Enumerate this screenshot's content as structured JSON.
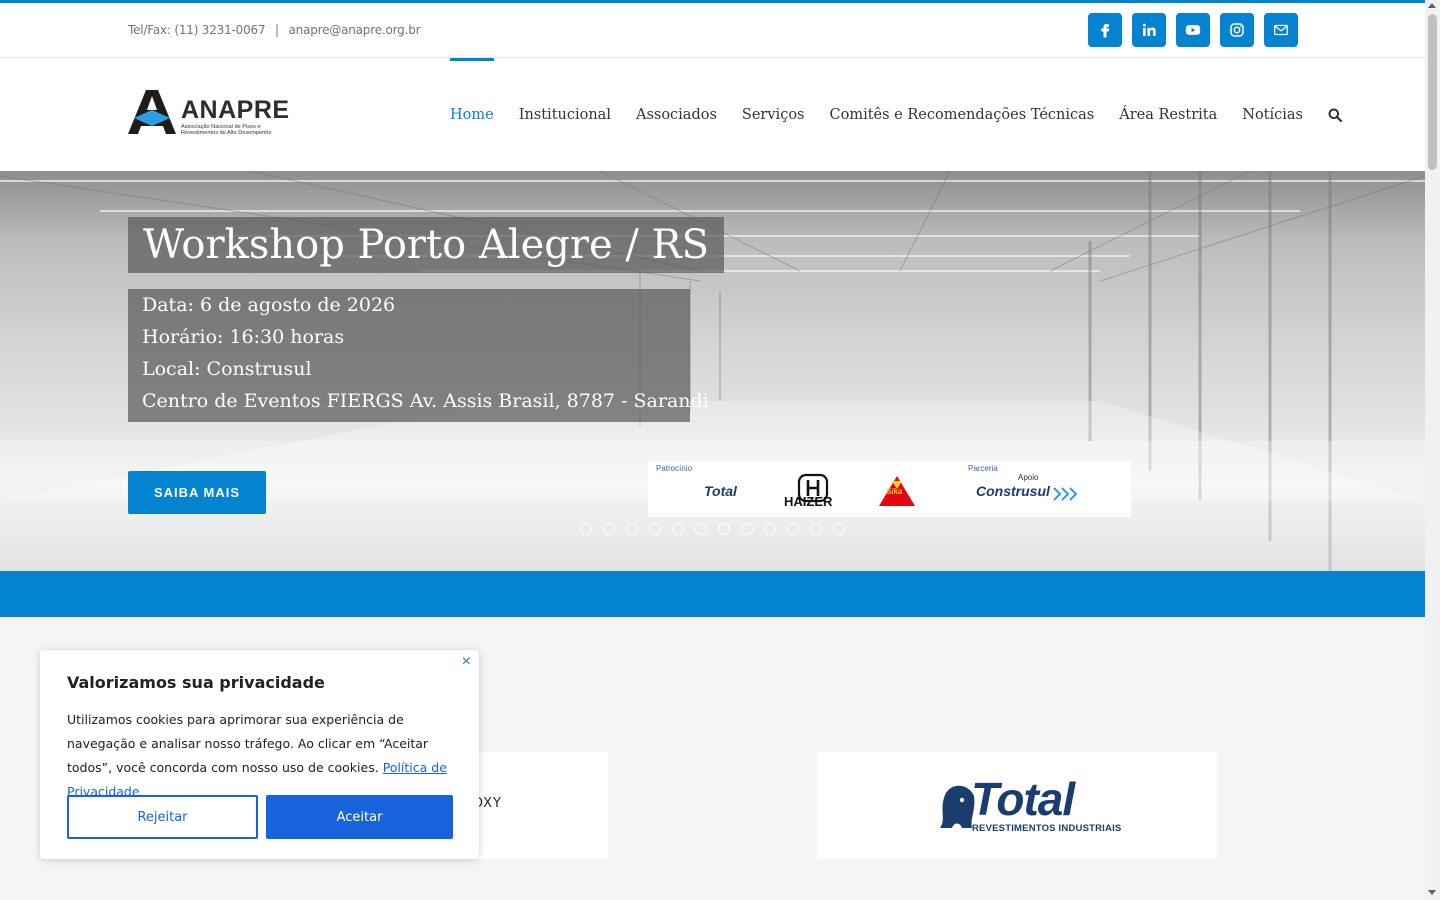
{
  "topbar": {
    "phone": "Tel/Fax: (11) 3231-0067",
    "separator": "|",
    "email": "anapre@anapre.org.br",
    "socials": [
      "facebook-icon",
      "linkedin-icon",
      "youtube-icon",
      "instagram-icon",
      "mail-icon"
    ]
  },
  "logo": {
    "name": "ANAPRE",
    "subtitle": "Associação Nacional de Pisos e Revestimentos de Alto Desempenho"
  },
  "nav": {
    "items": [
      {
        "label": "Home",
        "active": true
      },
      {
        "label": "Institucional",
        "active": false
      },
      {
        "label": "Associados",
        "active": false
      },
      {
        "label": "Serviços",
        "active": false
      },
      {
        "label": "Comitês e Recomendações Técnicas",
        "active": false
      },
      {
        "label": "Área Restrita",
        "active": false
      },
      {
        "label": "Notícias",
        "active": false
      }
    ],
    "search_icon": "search-icon"
  },
  "hero": {
    "title": "Workshop Porto Alegre / RS",
    "lines": [
      "Data: 6 de agosto de 2026",
      "Horário: 16:30 horas",
      "Local: Construsul",
      "Centro de Eventos FIERGS Av. Assis Brasil, 8787 - Sarandi"
    ],
    "button_label": "SAIBA MAIS",
    "sponsors": {
      "patrocinio_label": "Patrocínio",
      "parceria_label": "Parceria",
      "apoio_label": "Apoio",
      "logos": [
        "Total",
        "HAIZER",
        "Sika",
        "Construsul"
      ]
    },
    "slide_count": 12,
    "active_slide": 0
  },
  "cards": {
    "card1_text": "OXY",
    "card2_logo": "Total",
    "card2_sub": "REVESTIMENTOS INDUSTRIAIS"
  },
  "cookie": {
    "title": "Valorizamos sua privacidade",
    "text": "Utilizamos cookies para aprimorar sua experiência de navegação e analisar nosso tráfego. Ao clicar em “Aceitar todos”, você concorda com nosso uso de cookies.",
    "link": "Política de Privacidade",
    "reject": "Rejeitar",
    "accept": "Aceitar",
    "close": "×"
  },
  "colors": {
    "brand_blue": "#0483d0",
    "cookie_blue": "#1863dc"
  }
}
